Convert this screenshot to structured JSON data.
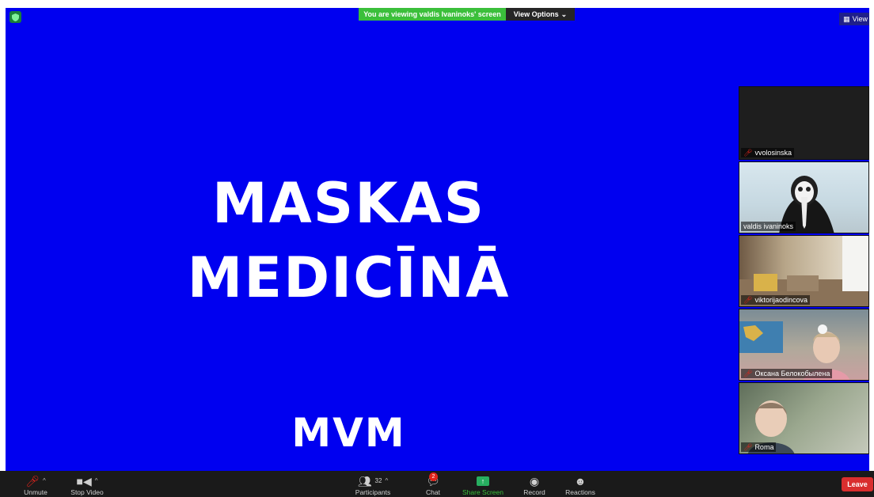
{
  "banner": {
    "viewing_text": "You are viewing valdis Ivaninoks' screen",
    "view_options_label": "View Options",
    "view_label": "View"
  },
  "shared_screen": {
    "title_line_1": "MASKAS",
    "title_line_2": "MEDICĪNĀ",
    "logo_text": "MVM",
    "background_color": "#0000f0"
  },
  "participants": [
    {
      "name": "vvolosinska",
      "muted": true
    },
    {
      "name": "valdis ivaninoks",
      "muted": false
    },
    {
      "name": "viktorijaodincova",
      "muted": true
    },
    {
      "name": "Оксана Белокобылена",
      "muted": true
    },
    {
      "name": "Roma",
      "muted": true
    }
  ],
  "toolbar": {
    "unmute_label": "Unmute",
    "stop_video_label": "Stop Video",
    "participants_label": "Participants",
    "participants_count": "32",
    "chat_label": "Chat",
    "chat_badge": "2",
    "share_screen_label": "Share Screen",
    "record_label": "Record",
    "reactions_label": "Reactions",
    "leave_label": "Leave"
  },
  "colors": {
    "accent_green": "#3bbf3b",
    "leave_red": "#d92e2e",
    "mute_red": "#e0241c"
  },
  "icons": {
    "mic": "mic-muted-icon",
    "video": "video-camera-icon",
    "participants": "participants-icon",
    "chat": "chat-bubble-icon",
    "share": "share-screen-icon",
    "record": "record-icon",
    "reactions": "reactions-icon"
  }
}
